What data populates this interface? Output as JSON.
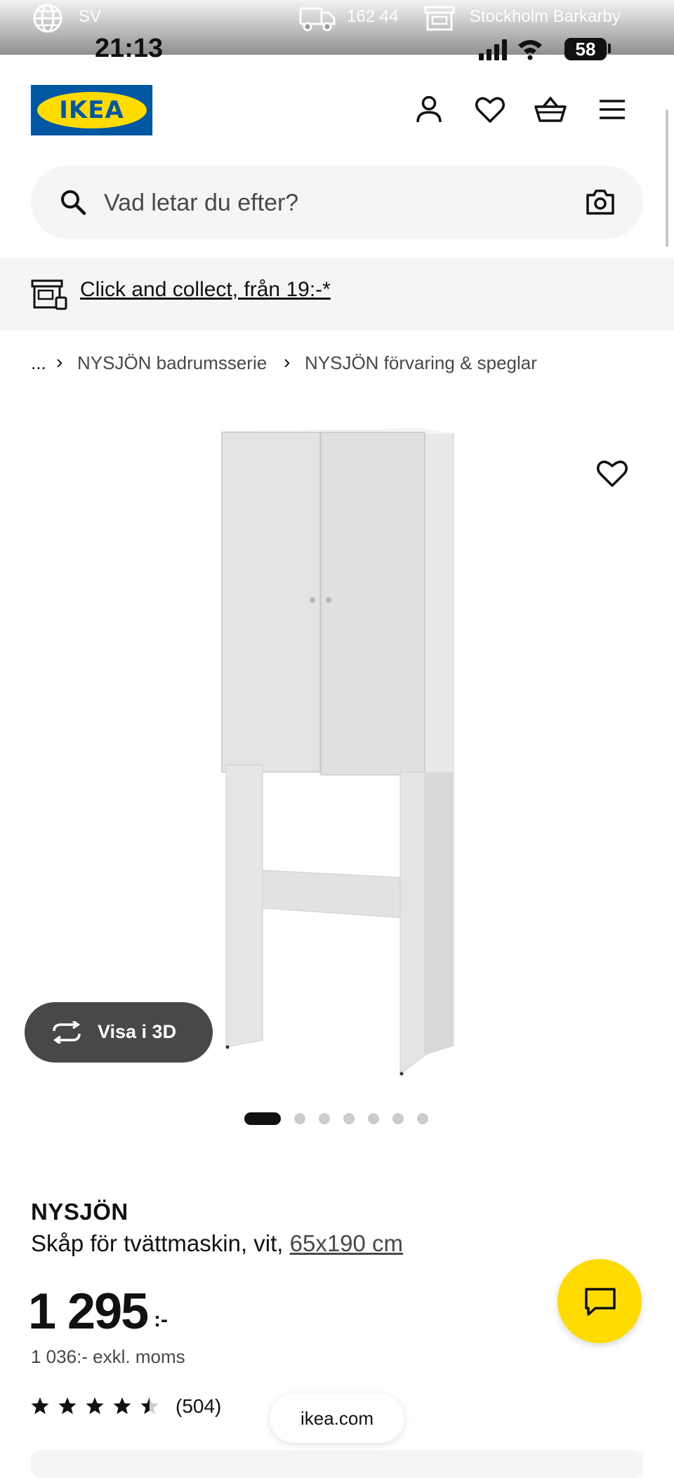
{
  "status_bar": {
    "language": "SV",
    "delivery_postcode": "162 44",
    "store": "Stockholm Barkarby",
    "time": "21:13",
    "battery": "58"
  },
  "header": {
    "logo_text": "IKEA",
    "brand_colors": {
      "blue": "#0058a3",
      "yellow": "#ffdb00"
    },
    "icons": [
      "account-icon",
      "wishlist-heart-icon",
      "cart-icon",
      "menu-icon"
    ]
  },
  "search": {
    "placeholder": "Vad letar du efter?"
  },
  "promo": {
    "text": "Click and collect, från 19:-*"
  },
  "breadcrumb": {
    "ellipsis": "...",
    "items": [
      "NYSJÖN badrumsserie",
      "NYSJÖN förvaring & speglar"
    ]
  },
  "gallery": {
    "view_3d_label": "Visa i 3D",
    "image_count": 7,
    "active_index": 0
  },
  "product": {
    "name": "NYSJÖN",
    "description": "Skåp för tvättmaskin, vit, ",
    "dimensions": "65x190 cm",
    "price": "1 295",
    "price_suffix": ":-",
    "price_ex_vat": "1 036:- exkl. moms",
    "rating": 4.5,
    "review_count": "(504)"
  },
  "browser": {
    "url": "ikea.com"
  }
}
